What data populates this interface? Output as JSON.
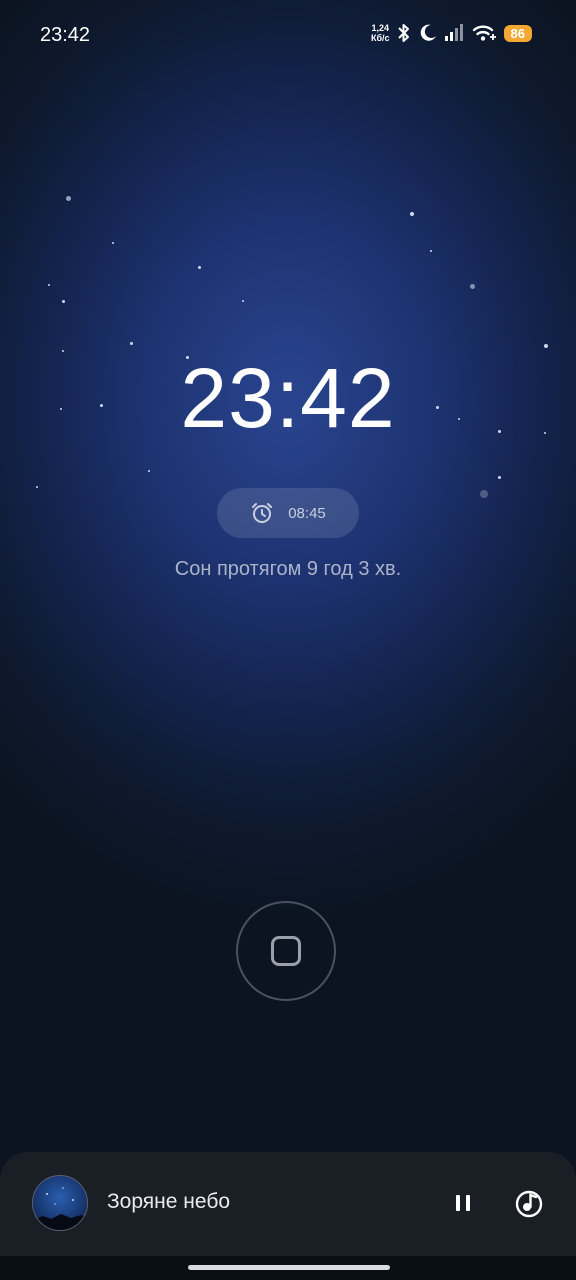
{
  "status_bar": {
    "time": "23:42",
    "net_speed_value": "1,24",
    "net_speed_unit": "Кб/с",
    "battery": "86",
    "icons": [
      "bluetooth-icon",
      "moon-icon",
      "signal-icon",
      "wifi-icon",
      "battery-icon"
    ]
  },
  "main": {
    "clock": "23:42",
    "alarm_time": "08:45",
    "sleep_duration_text": "Сон протягом 9 год 3 хв."
  },
  "player": {
    "track_title": "Зоряне небо"
  },
  "colors": {
    "battery_badge": "#f2a832",
    "background_center": "#2a4590",
    "background_edge": "#0c1421"
  }
}
